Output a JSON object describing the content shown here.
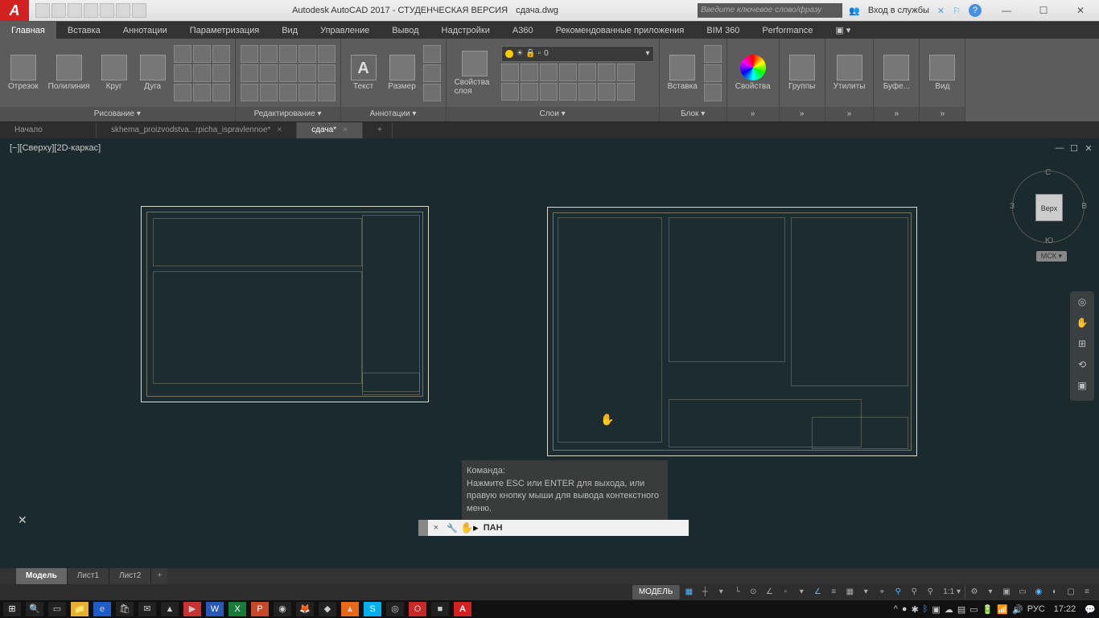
{
  "title": {
    "app": "Autodesk AutoCAD 2017 - СТУДЕНЧЕСКАЯ ВЕРСИЯ",
    "file": "сдача.dwg"
  },
  "search": {
    "placeholder": "Введите ключевое слово/фразу"
  },
  "signin": {
    "label": "Вход в службы"
  },
  "ribbon_tabs": [
    "Главная",
    "Вставка",
    "Аннотации",
    "Параметризация",
    "Вид",
    "Управление",
    "Вывод",
    "Надстройки",
    "A360",
    "Рекомендованные приложения",
    "BIM 360",
    "Performance"
  ],
  "panels": {
    "draw": {
      "title": "Рисование ▾",
      "items": [
        "Отрезок",
        "Полилиния",
        "Круг",
        "Дуга"
      ]
    },
    "modify": {
      "title": "Редактирование ▾"
    },
    "annot": {
      "title": "Аннотации ▾",
      "items": [
        "Текст",
        "Размер"
      ]
    },
    "layers": {
      "title": "Слои ▾",
      "props": "Свойства слоя",
      "current": "0"
    },
    "block": {
      "title": "Блок ▾",
      "items": [
        "Вставка"
      ]
    },
    "props": {
      "title": "Свойства"
    },
    "groups": {
      "title": "Группы"
    },
    "util": {
      "title": "Утилиты"
    },
    "clip": {
      "title": "Буфе..."
    },
    "view": {
      "title": "Вид"
    }
  },
  "doc_tabs": {
    "start": "Начало",
    "tab1": "skhema_proizvodstva...rpicha_ispravlennoe*",
    "tab2": "сдача*"
  },
  "viewport": {
    "label": "[−][Сверху][2D-каркас]"
  },
  "viewcube": {
    "face": "Верх",
    "n": "С",
    "s": "Ю",
    "e": "В",
    "w": "З",
    "wcs": "МСК ▾"
  },
  "command": {
    "prompt": "Команда:",
    "hint": "Нажмите ESC или ENTER для выхода, или правую кнопку мыши для вывода контекстного меню.",
    "active": "ПАН"
  },
  "layout_tabs": [
    "Модель",
    "Лист1",
    "Лист2"
  ],
  "status": {
    "model": "МОДЕЛЬ",
    "scale": "1:1 ▾"
  },
  "taskbar": {
    "lang": "РУС",
    "time": "17:22"
  }
}
